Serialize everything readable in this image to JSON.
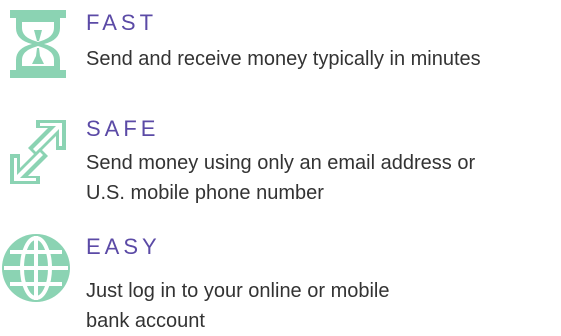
{
  "colors": {
    "accent": "#5b4aa6",
    "icon": "#8bd3b3",
    "text": "#333333"
  },
  "features": [
    {
      "icon": "hourglass-icon",
      "title": "FAST",
      "lines": [
        "Send and receive money typically in minutes"
      ]
    },
    {
      "icon": "arrows-exchange-icon",
      "title": "SAFE",
      "lines": [
        "Send money using only an email address or",
        "U.S. mobile phone number"
      ]
    },
    {
      "icon": "globe-icon",
      "title": "EASY",
      "lines": [
        "Just log in to your online or mobile",
        "bank account"
      ]
    }
  ]
}
